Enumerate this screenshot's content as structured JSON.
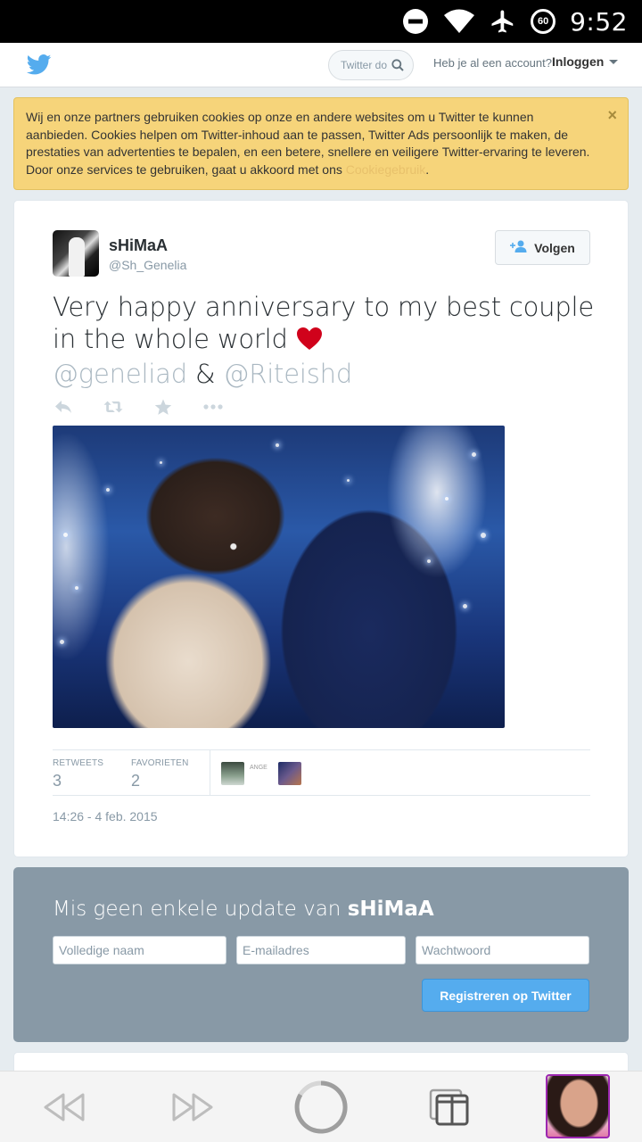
{
  "status_bar": {
    "time": "9:52",
    "battery_level": "60",
    "icons": [
      "do-not-disturb-icon",
      "wifi-icon",
      "airplane-icon",
      "battery-icon"
    ]
  },
  "nav": {
    "logo": "twitter-bird-icon",
    "search_placeholder": "Twitter doorzoeken",
    "account_text": "Heb je al een account?",
    "login_label": "Inloggen"
  },
  "cookie_banner": {
    "text": "Wij en onze partners gebruiken cookies op onze en andere websites om u Twitter te kunnen aanbieden. Cookies helpen om Twitter-inhoud aan te passen, Twitter Ads persoonlijk te maken, de prestaties van advertenties te bepalen, en een betere, snellere en veiligere Twitter-ervaring te leveren. Door onze services te gebruiken, gaat u akkoord met ons ",
    "link_label": "Cookiegebruik",
    "suffix": ".",
    "close_label": "×"
  },
  "tweet": {
    "name": "sHiMaA",
    "handle": "@Sh_Genelia",
    "follow_label": "Volgen",
    "text_line": "Very happy anniversary to my best couple in the whole world",
    "mention_1": "@geneliad",
    "amp": "&",
    "mention_2": "@Riteishd",
    "retweets_label": "RETWEETS",
    "retweets_count": "3",
    "favorites_label": "FAVORIETEN",
    "favorites_count": "2",
    "fav_alt_text": "ANGE",
    "timestamp": "14:26 - 4 feb. 2015"
  },
  "signup": {
    "title_prefix": "Mis geen enkele update van ",
    "title_name": "sHiMaA",
    "name_placeholder": "Volledige naam",
    "email_placeholder": "E-mailadres",
    "password_placeholder": "Wachtwoord",
    "register_label": "Registreren op Twitter"
  },
  "colors": {
    "twitter_blue": "#55acee",
    "cookie_bg": "#f6d47a",
    "signup_bg": "#8899a6",
    "heart": "#d0021b",
    "avatar_border": "#9c27b0"
  }
}
